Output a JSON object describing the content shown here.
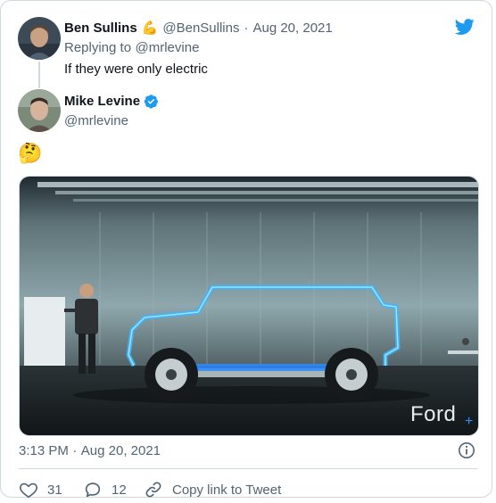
{
  "reply_tweet": {
    "author_name": "Ben Sullins",
    "author_emoji": "💪",
    "author_handle": "@BenSullins",
    "separator": "·",
    "date": "Aug 20, 2021",
    "replying_to_prefix": "Replying to",
    "replying_to_handle": "@mrlevine",
    "text": "If they were only electric"
  },
  "main_tweet": {
    "author_name": "Mike Levine",
    "author_handle": "@mrlevine",
    "emoji": "🤔",
    "time": "3:13 PM",
    "separator": "·",
    "date": "Aug 20, 2021",
    "media": {
      "logo_text": "Ford"
    }
  },
  "actions": {
    "likes": "31",
    "replies": "12",
    "copy_link_label": "Copy link to Tweet"
  },
  "icons": {
    "brand": "twitter-bird-icon",
    "verified": "verified-badge-icon",
    "info": "info-icon",
    "like": "heart-icon",
    "reply": "reply-bubble-icon",
    "copy": "link-icon"
  },
  "colors": {
    "twitter_blue": "#1d9bf0",
    "text": "#0f1419",
    "muted": "#536471",
    "border": "#cfd9de"
  }
}
